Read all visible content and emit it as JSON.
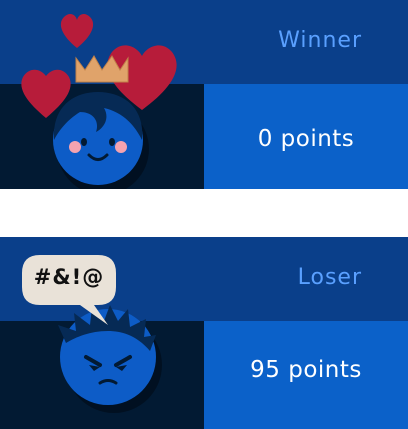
{
  "winner": {
    "title": "Winner",
    "points": "0 points",
    "icons": [
      "heart-icon",
      "crown-icon",
      "happy-face-avatar"
    ]
  },
  "loser": {
    "title": "Loser",
    "points": "95 points",
    "speech": "#&!@",
    "icons": [
      "speech-bubble-icon",
      "angry-face-avatar"
    ]
  },
  "colors": {
    "top_band": "#0a3f8a",
    "left_band": "#021a33",
    "right_band": "#0b61c9",
    "title_text": "#5aa0ff",
    "heart": "#b71c3a",
    "crown": "#e0a36a"
  }
}
